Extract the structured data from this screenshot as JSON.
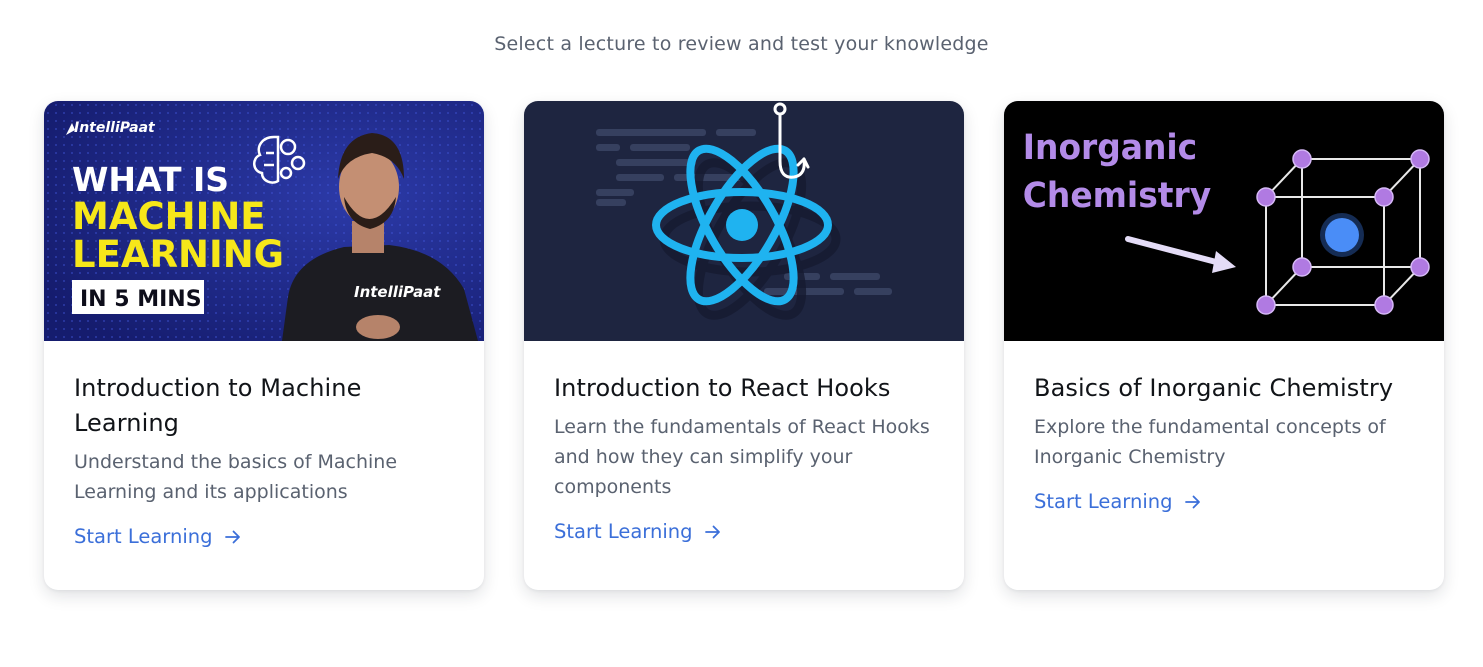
{
  "subtitle": "Select a lecture to review and test your knowledge",
  "cards": [
    {
      "title": "Introduction to Machine Learning",
      "description": "Understand the basics of Machine Learning and its applications",
      "link_label": "Start Learning",
      "thumbnail": {
        "brand": "IntelliPaat",
        "line1": "WHAT IS",
        "line2": "MACHINE",
        "line3": "LEARNING",
        "badge": "IN 5 MINS",
        "shirt_brand": "IntelliPaat"
      }
    },
    {
      "title": "Introduction to React Hooks",
      "description": "Learn the fundamentals of React Hooks and how they can simplify your components",
      "link_label": "Start Learning"
    },
    {
      "title": "Basics of Inorganic Chemistry",
      "description": "Explore the fundamental concepts of Inorganic Chemistry",
      "link_label": "Start Learning",
      "thumbnail": {
        "line1": "Inorganic",
        "line2": "Chemistry"
      }
    }
  ],
  "colors": {
    "link": "#3b6fd9",
    "title": "#111418",
    "muted": "#5a6270",
    "ml_thumb_bg": "#1b237f",
    "ml_yellow": "#f6e71a",
    "react_thumb_bg": "#1e2540",
    "react_blue": "#1fb3f0",
    "chem_thumb_bg": "#000000",
    "chem_purple": "#b38be8"
  }
}
